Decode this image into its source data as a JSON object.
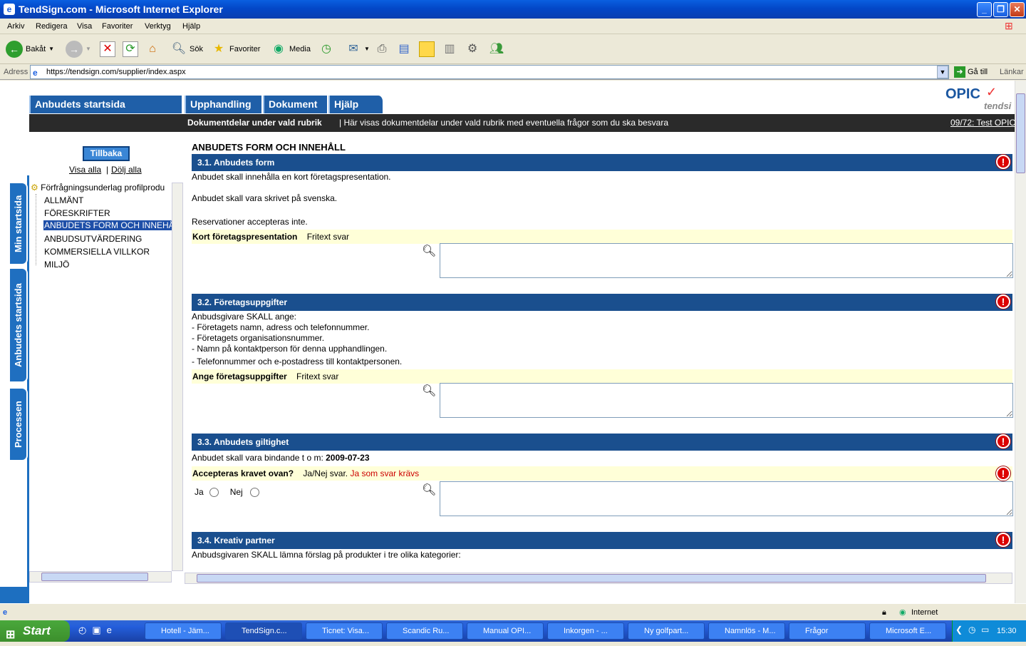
{
  "window": {
    "title": "TendSign.com - Microsoft Internet Explorer"
  },
  "menu": [
    "Arkiv",
    "Redigera",
    "Visa",
    "Favoriter",
    "Verktyg",
    "Hjälp"
  ],
  "toolbar": {
    "back": "Bakåt",
    "search": "Sök",
    "favorites": "Favoriter",
    "media": "Media"
  },
  "address": {
    "label": "Adress",
    "url": "https://tendsign.com/supplier/index.aspx",
    "go": "Gå till",
    "links": "Länkar"
  },
  "site": {
    "logo": "OPIC",
    "logo_sub": "tendsi",
    "tabs": [
      "Anbudets startsida",
      "Upphandling",
      "Dokument",
      "Hjälp"
    ],
    "bar_title": "Dokumentdelar under vald rubrik",
    "bar_desc": "Här visas dokumentdelar under vald rubrik med eventuella frågor som du ska besvara",
    "bar_right": "09/72: Test OPIC",
    "side_tabs": [
      "Min startsida",
      "Anbudets startsida",
      "Processen"
    ],
    "back_btn": "Tillbaka",
    "show_all": "Visa alla",
    "hide_all": "Dölj alla",
    "tree_root": "Förfrågningsunderlag profilprodu",
    "tree_items": [
      "ALLMÄNT",
      "FÖRESKRIFTER",
      "ANBUDETS FORM OCH INNEHÅ",
      "ANBUDSUTVÄRDERING",
      "KOMMERSIELLA VILLKOR",
      "MILJÖ"
    ],
    "page_heading": "ANBUDETS FORM OCH INNEHÅLL"
  },
  "sections": [
    {
      "title": "3.1. Anbudets form",
      "lines": [
        "Anbudet skall innehålla en kort företagspresentation.",
        "Anbudet skall vara skrivet på svenska.",
        "Reservationer accepteras inte."
      ],
      "q_label": "Kort företagspresentation",
      "q_type": "Fritext svar"
    },
    {
      "title": "3.2. Företagsuppgifter",
      "lines": [
        "Anbudsgivare SKALL ange:",
        "- Företagets namn, adress och telefonnummer.",
        "- Företagets organisationsnummer.",
        "- Namn på kontaktperson för denna upphandlingen.",
        "- Telefonnummer och e-postadress till kontaktpersonen."
      ],
      "q_label": "Ange företagsuppgifter",
      "q_type": "Fritext svar"
    },
    {
      "title": "3.3. Anbudets giltighet",
      "line_prefix": "Anbudet skall vara bindande t o m:",
      "line_date": "2009-07-23",
      "q_label": "Accepteras kravet ovan?",
      "q_type": "Ja/Nej svar.",
      "q_req": "Ja som svar krävs",
      "yes": "Ja",
      "no": "Nej"
    },
    {
      "title": "3.4. Kreativ partner",
      "lines": [
        "Anbudsgivaren SKALL lämna förslag på produkter i tre olika kategorier:"
      ]
    }
  ],
  "status": {
    "zone": "Internet"
  },
  "taskbar": {
    "start": "Start",
    "tasks": [
      "Hotell - Jäm...",
      "TendSign.c...",
      "Ticnet: Visa...",
      "Scandic Ru...",
      "Manual OPI...",
      "Inkorgen - ...",
      "Ny golfpart...",
      "Namnlös - M...",
      "Frågor",
      "Microsoft E..."
    ],
    "clock": "15:30"
  }
}
